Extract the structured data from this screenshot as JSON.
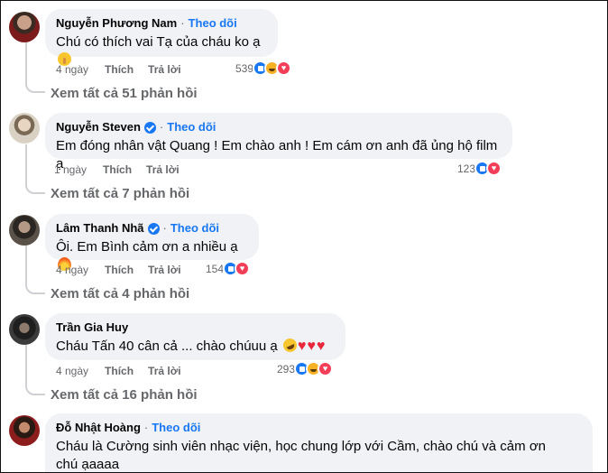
{
  "colors": {
    "accent": "#1877f2",
    "bubble": "#f0f2f5",
    "muted": "#65676b"
  },
  "comments": [
    {
      "name": "Nguyễn Phương Nam",
      "follow": "Theo dõi",
      "verified": false,
      "text": "Chú có thích vai Tạ của cháu ko ạ",
      "emoji": [
        "shushing-face-icon"
      ],
      "time": "4 ngày",
      "like": "Thích",
      "reply": "Trả lời",
      "reactions": {
        "count": "539",
        "icons": [
          "like",
          "haha",
          "love"
        ]
      },
      "more_replies": "Xem tất cả 51 phản hồi"
    },
    {
      "name": "Nguyễn Steven",
      "follow": "Theo dõi",
      "verified": true,
      "text": "Em đóng nhân vật Quang ! Em chào anh ! Em cám ơn anh đã ủng hộ film ạ",
      "time": "1 ngày",
      "like": "Thích",
      "reply": "Trả lời",
      "reactions": {
        "count": "123",
        "icons": [
          "like",
          "love"
        ]
      },
      "more_replies": "Xem tất cả 7 phản hồi"
    },
    {
      "name": "Lâm Thanh Nhã",
      "follow": "Theo dõi",
      "verified": true,
      "text": "Ôi. Em Bình cảm ơn a nhiều ạ",
      "emoji": [
        "fire-icon"
      ],
      "time": "4 ngày",
      "like": "Thích",
      "reply": "Trả lời",
      "reactions": {
        "count": "154",
        "icons": [
          "like",
          "love"
        ]
      },
      "more_replies": "Xem tất cả 4 phản hồi"
    },
    {
      "name": "Trần Gia Huy",
      "follow": "",
      "verified": false,
      "text": "Cháu Tấn 40 cân cả ... chào chúuu ạ",
      "emoji": [
        "rofl-icon",
        "heart-icon",
        "heart-icon",
        "heart-icon"
      ],
      "time": "4 ngày",
      "like": "Thích",
      "reply": "Trả lời",
      "reactions": {
        "count": "293",
        "icons": [
          "like",
          "haha",
          "love"
        ]
      },
      "more_replies": "Xem tất cả 16 phản hồi"
    },
    {
      "name": "Đỗ Nhật Hoàng",
      "follow": "Theo dõi",
      "verified": false,
      "text": "Cháu là Cường sinh viên nhạc viện, học chung lớp với Cầm, chào chú và cảm ơn chú ạaaaa"
    }
  ]
}
